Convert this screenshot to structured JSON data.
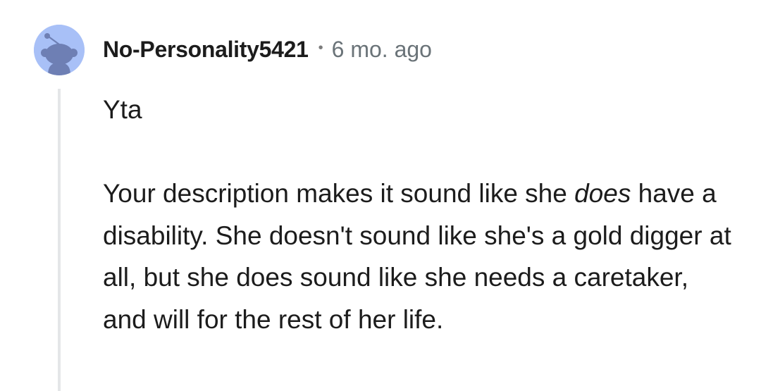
{
  "comment": {
    "author": "No-Personality5421",
    "separator": "•",
    "time": "6 mo. ago",
    "avatar_icon": "snoo-avatar-icon",
    "avatar_color": "#a8c0f7",
    "paragraph1": "Yta",
    "paragraph2_before": "Your description makes it sound like she ",
    "paragraph2_emphasis": "does",
    "paragraph2_after": " have a disability. She doesn't sound like she's a gold digger at all, but she does sound like she needs a caretaker, and will for the rest of her life."
  }
}
